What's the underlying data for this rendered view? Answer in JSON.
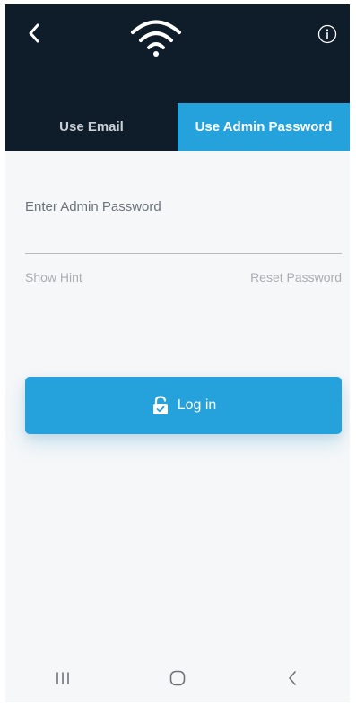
{
  "header": {
    "back_icon": "chevron-left-icon",
    "logo_icon": "wifi-icon",
    "info_icon": "info-icon"
  },
  "tabs": [
    {
      "label": "Use Email",
      "active": false
    },
    {
      "label": "Use Admin Password",
      "active": true
    }
  ],
  "form": {
    "password_label": "Enter Admin Password",
    "password_value": "",
    "show_hint_label": "Show Hint",
    "reset_password_label": "Reset Password",
    "login_label": "Log in",
    "login_icon": "unlock-icon"
  },
  "navbar": {
    "recent_icon": "recent-apps-icon",
    "home_icon": "home-icon",
    "back_icon": "back-icon"
  },
  "colors": {
    "header_bg": "#0f1d2b",
    "accent": "#25a2dc",
    "background": "#f6f7f8"
  }
}
